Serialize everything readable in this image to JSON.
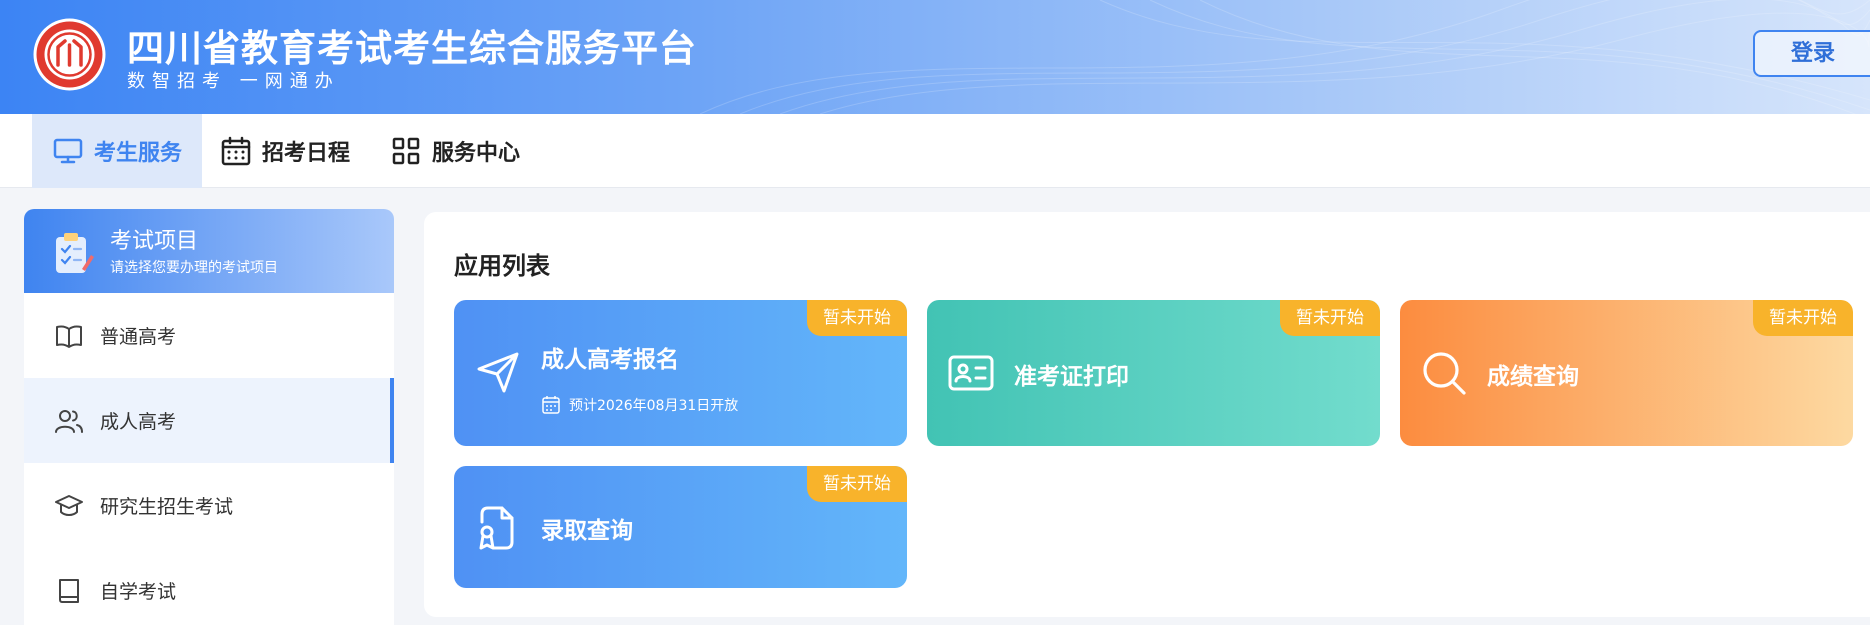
{
  "header": {
    "title": "四川省教育考试考生综合服务平台",
    "subtitle": "数智招考 一网通办",
    "login_label": "登录"
  },
  "nav": {
    "items": [
      {
        "label": "考生服务",
        "icon": "monitor-icon",
        "active": true
      },
      {
        "label": "招考日程",
        "icon": "calendar-icon",
        "active": false
      },
      {
        "label": "服务中心",
        "icon": "grid-icon",
        "active": false
      }
    ]
  },
  "sidebar": {
    "title": "考试项目",
    "subtitle": "请选择您要办理的考试项目",
    "items": [
      {
        "label": "普通高考",
        "icon": "book-open-icon",
        "active": false
      },
      {
        "label": "成人高考",
        "icon": "users-icon",
        "active": true
      },
      {
        "label": "研究生招生考试",
        "icon": "graduation-cap-icon",
        "active": false
      },
      {
        "label": "自学考试",
        "icon": "book-icon",
        "active": false
      }
    ]
  },
  "main": {
    "title": "应用列表",
    "cards": [
      {
        "title": "成人高考报名",
        "subtitle": "预计2026年08月31日开放",
        "badge": "暂未开始",
        "icon": "send-icon",
        "color": "#4f91f4"
      },
      {
        "title": "准考证打印",
        "badge": "暂未开始",
        "icon": "id-card-icon",
        "color": "#42c3b4"
      },
      {
        "title": "成绩查询",
        "badge": "暂未开始",
        "icon": "search-icon",
        "color": "#fc8c3f"
      },
      {
        "title": "录取查询",
        "badge": "暂未开始",
        "icon": "certificate-file-icon",
        "color": "#4f91f4"
      }
    ]
  },
  "colors": {
    "accent": "#3f84f0",
    "badge": "#f8b32b"
  }
}
